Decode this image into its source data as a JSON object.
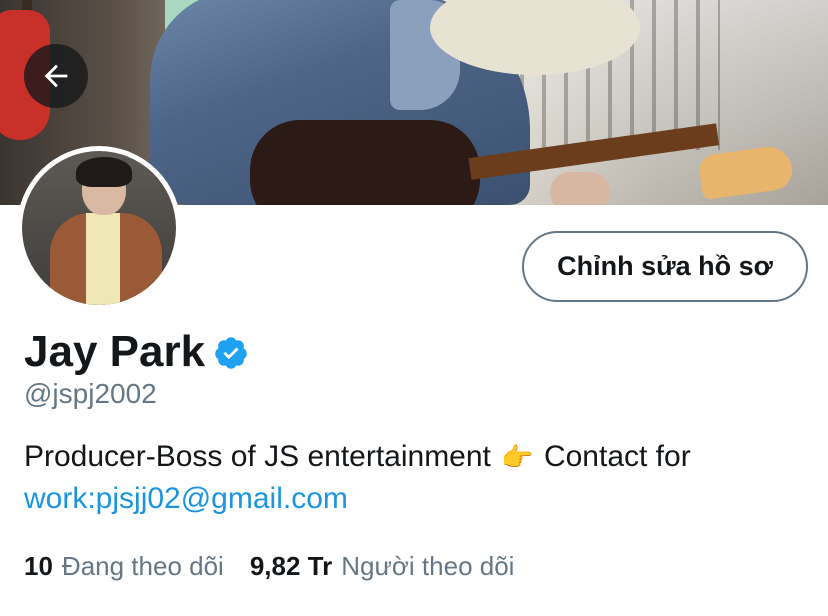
{
  "profile": {
    "display_name": "Jay Park",
    "handle": "@jspj2002",
    "bio_text": "Producer-Boss of JS entertainment",
    "bio_text_2": "Contact for",
    "bio_link": "work:pjsjj02@gmail.com",
    "bio_emoji": "👉"
  },
  "actions": {
    "edit_profile_label": "Chỉnh sửa hồ sơ"
  },
  "stats": {
    "following_count": "10",
    "following_label": "Đang theo dõi",
    "followers_count": "9,82 Tr",
    "followers_label": "Người theo dõi"
  },
  "icons": {
    "back": "back-arrow-icon",
    "verified": "verified-badge-icon"
  },
  "colors": {
    "accent": "#1b95e0",
    "verified": "#1da1f2",
    "secondary_text": "#657786",
    "primary_text": "#14171a"
  }
}
